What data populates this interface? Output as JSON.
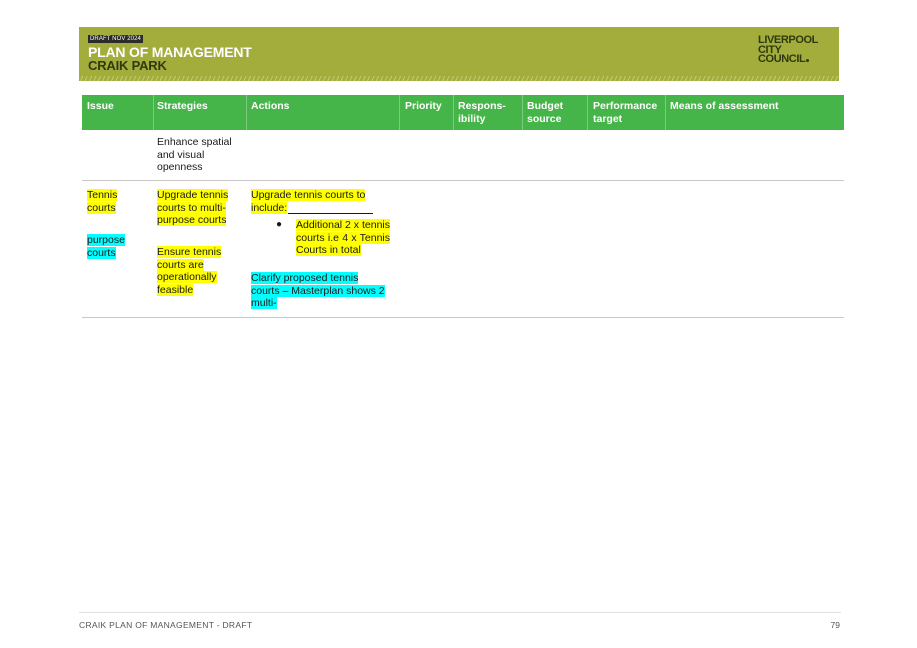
{
  "banner": {
    "draft_tag": "DRAFT NOV 2024",
    "title": "PLAN OF MANAGEMENT",
    "subtitle": "CRAIK PARK",
    "logo_lines": [
      "LIVERPOOL",
      "CITY",
      "COUNCIL"
    ],
    "color": "#a3ad3c"
  },
  "table": {
    "header_color": "#45b54a",
    "columns": [
      "Issue",
      "Strategies",
      "Actions",
      "Priority",
      "Respons-\nibility",
      "Budget\nsource",
      "Performance\ntarget",
      "Means of assessment"
    ],
    "row1": {
      "strategy": "Enhance spatial\nand visual\nopenness"
    },
    "row2": {
      "issue_1": "Tennis\ncourts",
      "issue_2": "purpose\ncourts",
      "strategy_1": "Upgrade tennis\ncourts to multi-\npurpose courts",
      "strategy_2": "Ensure tennis\ncourts are\noperationally\nfeasible",
      "action_intro_1": "Upgrade tennis courts to",
      "action_intro_2": "include:",
      "action_bullet": "Additional 2 x tennis courts i.e 4 x Tennis Courts in total",
      "action_note": "Clarify proposed tennis\ncourts – Masterplan shows 2\nmulti-"
    }
  },
  "highlight_colors": {
    "yellow": "#ffff00",
    "cyan": "#00ffff"
  },
  "footer": {
    "left": "CRAIK PLAN OF MANAGEMENT - DRAFT",
    "page": "79"
  }
}
